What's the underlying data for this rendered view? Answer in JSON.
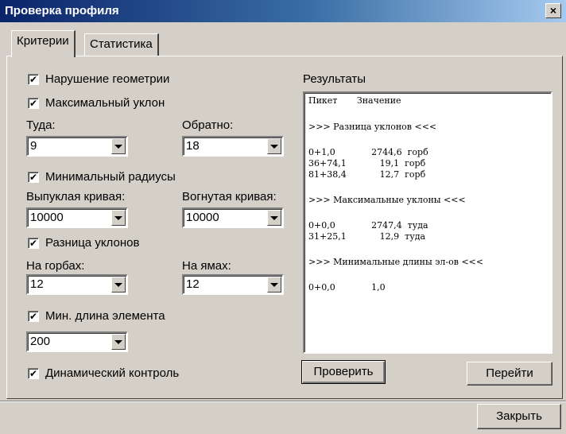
{
  "window": {
    "title": "Проверка профиля",
    "close_glyph": "×",
    "close_icon": "close-icon"
  },
  "tabs": [
    {
      "label": "Критерии",
      "active": true
    },
    {
      "label": "Статистика",
      "active": false
    }
  ],
  "criteria": {
    "geometry_violation": {
      "label": "Нарушение геометрии",
      "checked": true
    },
    "max_slope": {
      "label": "Максимальный уклон",
      "checked": true
    },
    "forward_label": "Туда:",
    "forward_value": "9",
    "backward_label": "Обратно:",
    "backward_value": "18",
    "min_radius": {
      "label": "Минимальный радиусы",
      "checked": true
    },
    "convex_label": "Выпуклая кривая:",
    "convex_value": "10000",
    "concave_label": "Вогнутая кривая:",
    "concave_value": "10000",
    "slope_diff": {
      "label": "Разница уклонов",
      "checked": true
    },
    "humps_label": "На горбах:",
    "humps_value": "12",
    "pits_label": "На ямах:",
    "pits_value": "12",
    "min_element_length": {
      "label": "Мин. длина элемента",
      "checked": true
    },
    "min_element_value": "200",
    "dynamic_control": {
      "label": "Динамический контроль",
      "checked": true
    },
    "check_mark": "✔"
  },
  "results": {
    "label": "Результаты",
    "lines": [
      "Пикет       Значение",
      ">>> Разница уклонов <<<",
      "0+1,0             2744,6  горб",
      "36+74,1            19,1  горб",
      "81+38,4            12,7  горб",
      ">>> Максимальные уклоны <<<",
      "0+0,0             2747,4  туда",
      "31+25,1            12,9  туда",
      ">>> Минимальные длины эл-ов <<<",
      "0+0,0             1,0"
    ]
  },
  "buttons": {
    "check": "Проверить",
    "goto": "Перейти",
    "close": "Закрыть"
  },
  "colors": {
    "title_start": "#0a246a",
    "title_end": "#a6caf0",
    "face": "#d4d0c8"
  }
}
